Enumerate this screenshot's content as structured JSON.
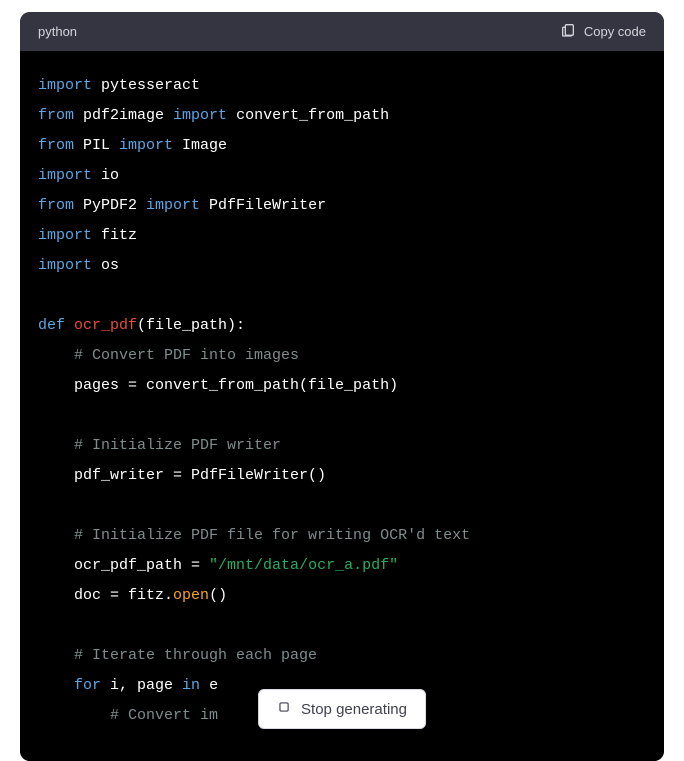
{
  "header": {
    "language": "python",
    "copy_label": "Copy code"
  },
  "code": {
    "line1_kw": "import",
    "line1_mod": " pytesseract",
    "line2_from": "from",
    "line2_mod": " pdf2image ",
    "line2_import": "import",
    "line2_item": " convert_from_path",
    "line3_from": "from",
    "line3_mod": " PIL ",
    "line3_import": "import",
    "line3_item": " Image",
    "line4_kw": "import",
    "line4_mod": " io",
    "line5_from": "from",
    "line5_mod": " PyPDF2 ",
    "line5_import": "import",
    "line5_item": " PdfFileWriter",
    "line6_kw": "import",
    "line6_mod": " fitz",
    "line7_kw": "import",
    "line7_mod": " os",
    "line9_def": "def",
    "line9_fn": " ocr_pdf",
    "line9_sig": "(file_path):",
    "line10_indent": "    ",
    "line10_comment": "# Convert PDF into images",
    "line11_indent": "    ",
    "line11_code": "pages = convert_from_path(file_path)",
    "line13_indent": "    ",
    "line13_comment": "# Initialize PDF writer",
    "line14_indent": "    ",
    "line14_code": "pdf_writer = PdfFileWriter()",
    "line16_indent": "    ",
    "line16_comment": "# Initialize PDF file for writing OCR'd text",
    "line17_indent": "    ",
    "line17_code_a": "ocr_pdf_path = ",
    "line17_str": "\"/mnt/data/ocr_a.pdf\"",
    "line18_indent": "    ",
    "line18_code_a": "doc = fitz.",
    "line18_method": "open",
    "line18_code_b": "()",
    "line20_indent": "    ",
    "line20_comment": "# Iterate through each page",
    "line21_indent": "    ",
    "line21_for": "for",
    "line21_mid": " i, page ",
    "line21_in": "in",
    "line21_tail": " e",
    "line22_indent": "        ",
    "line22_comment": "# Convert im"
  },
  "stop": {
    "label": "Stop generating"
  }
}
